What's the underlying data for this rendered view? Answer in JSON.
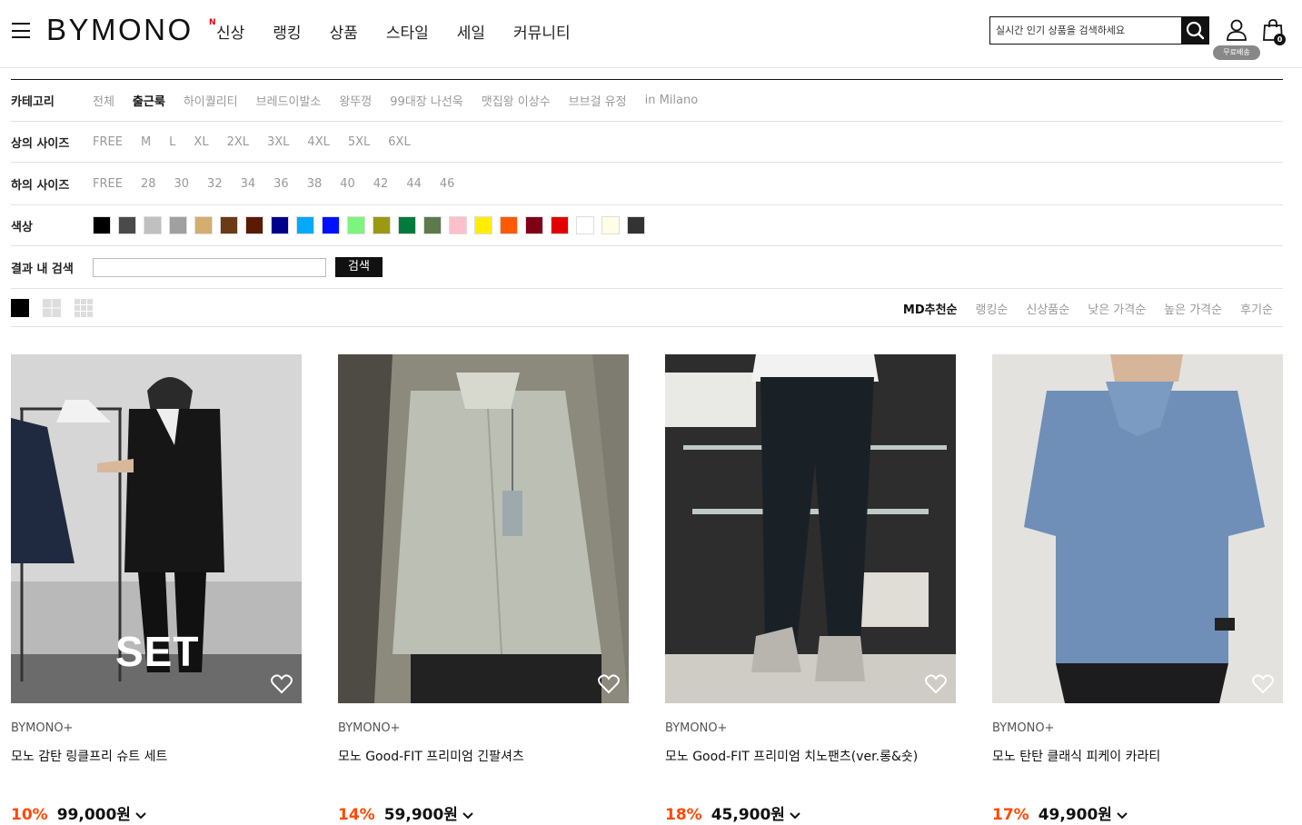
{
  "header": {
    "logo": "BYMONO",
    "nav": [
      {
        "label": "신상",
        "badge": "N"
      },
      {
        "label": "랭킹",
        "badge": ""
      },
      {
        "label": "상품",
        "badge": ""
      },
      {
        "label": "스타일",
        "badge": ""
      },
      {
        "label": "세일",
        "badge": ""
      },
      {
        "label": "커뮤니티",
        "badge": ""
      }
    ],
    "search_placeholder": "실시간 인기 상품을 검색하세요",
    "free_shipping": "무료배송",
    "cart_count": "0"
  },
  "filters": {
    "category_label": "카테고리",
    "categories": [
      "전체",
      "출근룩",
      "하이퀄리티",
      "브레드이발소",
      "왕뚜껑",
      "99대장 나선욱",
      "맷집왕 이상수",
      "브브걸 유정",
      "in Milano"
    ],
    "category_active": "출근룩",
    "top_size_label": "상의 사이즈",
    "top_sizes": [
      "FREE",
      "M",
      "L",
      "XL",
      "2XL",
      "3XL",
      "4XL",
      "5XL",
      "6XL"
    ],
    "bottom_size_label": "하의 사이즈",
    "bottom_sizes": [
      "FREE",
      "28",
      "30",
      "32",
      "34",
      "36",
      "38",
      "40",
      "42",
      "44",
      "46"
    ],
    "color_label": "색상",
    "colors": [
      "#000000",
      "#4a4a4a",
      "#c0c0c0",
      "#a0a0a0",
      "#d4ae6e",
      "#6b3a17",
      "#5a1a04",
      "#00008b",
      "#00aaff",
      "#0011ff",
      "#7cf57c",
      "#9a9a12",
      "#007a3d",
      "#5c7a4c",
      "#ffc0cb",
      "#ffee00",
      "#ff5a00",
      "#800018",
      "#e30000",
      "#ffffff",
      "#fffde8",
      "#333333"
    ],
    "search_label": "결과 내 검색",
    "search_button": "검색"
  },
  "sort": {
    "options": [
      "MD추천순",
      "랭킹순",
      "신상품순",
      "낮은 가격순",
      "높은 가격순",
      "후기순"
    ],
    "active": "MD추천순"
  },
  "products": [
    {
      "brand": "BYMONO+",
      "name": "모노 감탄 링클프리 슈트 세트",
      "discount": "10%",
      "price": "99,000원",
      "overlay": "SET"
    },
    {
      "brand": "BYMONO+",
      "name": "모노 Good-FIT 프리미엄 긴팔셔츠",
      "discount": "14%",
      "price": "59,900원",
      "overlay": ""
    },
    {
      "brand": "BYMONO+",
      "name": "모노 Good-FIT 프리미엄 치노팬츠(ver.롱&숏)",
      "discount": "18%",
      "price": "45,900원",
      "overlay": ""
    },
    {
      "brand": "BYMONO+",
      "name": "모노 탄탄 클래식 피케이 카라티",
      "discount": "17%",
      "price": "49,900원",
      "overlay": ""
    }
  ]
}
